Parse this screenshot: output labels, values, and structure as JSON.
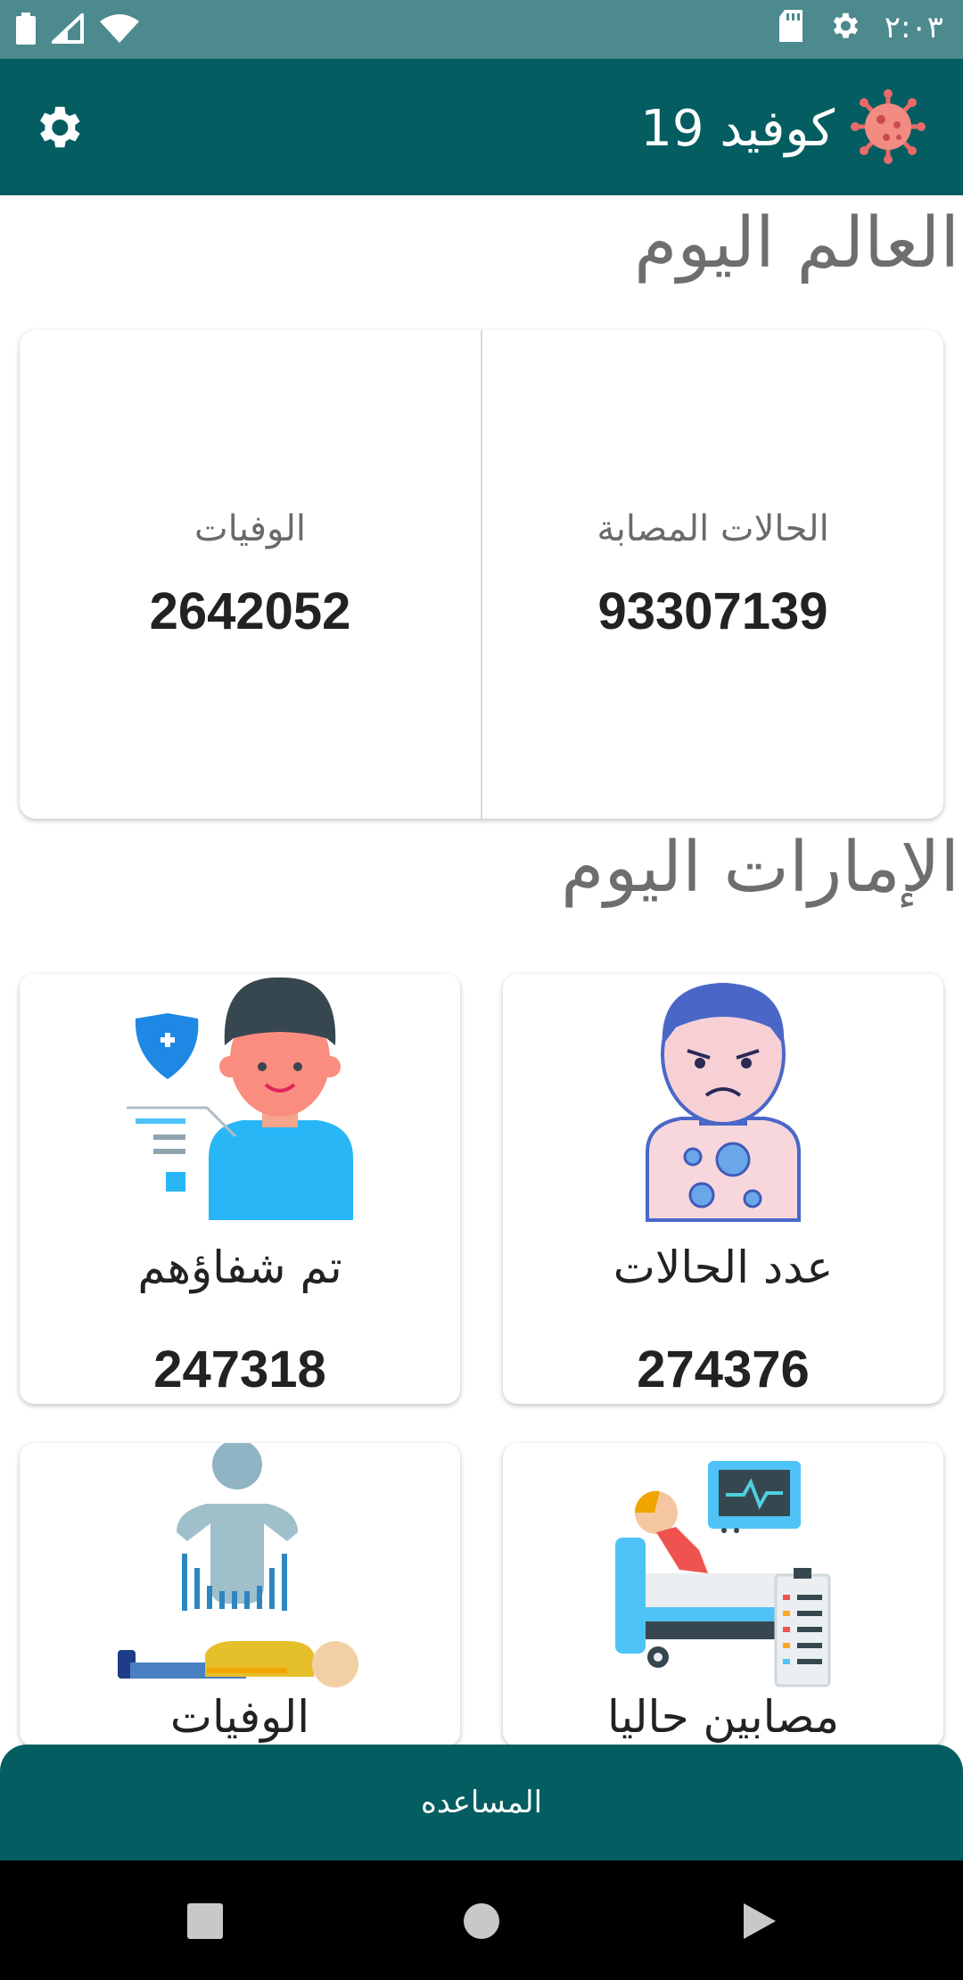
{
  "status_bar": {
    "time": "٢:٠٣",
    "icons": [
      "battery-icon",
      "signal-icon",
      "wifi-icon",
      "sd-card-icon",
      "settings-gear-icon"
    ]
  },
  "app_bar": {
    "title": "كوفيد 19",
    "logo_icon": "virus-icon",
    "settings_icon": "gear-icon"
  },
  "world_today": {
    "title": "العالم اليوم",
    "cases_label": "الحالات المصابة",
    "cases_value": "93307139",
    "deaths_label": "الوفيات",
    "deaths_value": "2642052"
  },
  "uae_today": {
    "title": "الإمارات اليوم",
    "tiles": [
      {
        "label": "عدد الحالات",
        "value": "274376",
        "icon": "sick-person-icon"
      },
      {
        "label": "تم شفاؤهم",
        "value": "247318",
        "icon": "recovered-person-icon"
      },
      {
        "label": "مصابين حاليا",
        "value": "",
        "icon": "hospital-bed-icon"
      },
      {
        "label": "الوفيات",
        "value": "",
        "icon": "deceased-person-icon"
      }
    ]
  },
  "help_button": {
    "label": "المساعده"
  },
  "colors": {
    "primary": "#035d61",
    "status_bar": "#4c8a8e"
  }
}
